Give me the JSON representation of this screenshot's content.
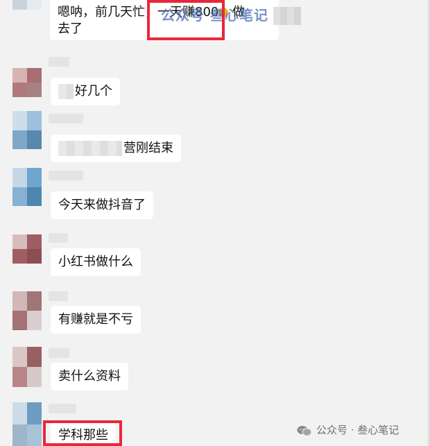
{
  "chat": {
    "messages": [
      {
        "text": "嗯呐，前几天忙，",
        "text2": "一天赚800",
        "text3": "做",
        "line2": "去了"
      },
      {
        "text": "好几个"
      },
      {
        "text": "营刚结束"
      },
      {
        "text": "今天来做抖音了"
      },
      {
        "text": "小红书做什么"
      },
      {
        "text": "有赚就是不亏"
      },
      {
        "text": "卖什么资料"
      },
      {
        "text": "学科那些"
      }
    ]
  },
  "watermark": {
    "top_text": "公众号 叁心笔记",
    "bottom_text": "公众号 · 叁心笔记"
  },
  "colors": {
    "highlight_border": "#e8283a",
    "watermark_blue": "#4a6fb5"
  }
}
